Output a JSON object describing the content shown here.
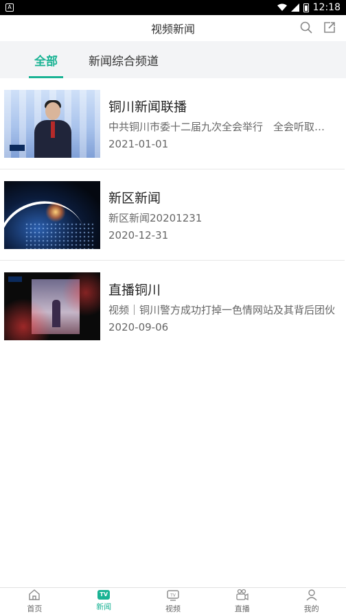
{
  "status_bar": {
    "time": "12:18"
  },
  "header": {
    "title": "视频新闻"
  },
  "tabs": [
    {
      "label": "全部",
      "active": true
    },
    {
      "label": "新闻综合频道",
      "active": false
    }
  ],
  "items": [
    {
      "title": "铜川新闻联播",
      "desc": "中共铜川市委十二届九次全会举行　全会听取和讨论了市委常委会工作报告",
      "date": "2021-01-01"
    },
    {
      "title": "新区新闻",
      "desc": "新区新闻20201231",
      "date": "2020-12-31"
    },
    {
      "title": "直播铜川",
      "desc": "视频｜铜川警方成功打掉一色情网站及其背后团伙",
      "date": "2020-09-06"
    }
  ],
  "bottom_nav": [
    {
      "label": "首页",
      "active": false
    },
    {
      "label": "新闻",
      "active": true,
      "badge": "TV"
    },
    {
      "label": "视频",
      "active": false
    },
    {
      "label": "直播",
      "active": false
    },
    {
      "label": "我的",
      "active": false
    }
  ],
  "colors": {
    "accent": "#1ab394",
    "tabs_bg": "#f3f4f6"
  }
}
